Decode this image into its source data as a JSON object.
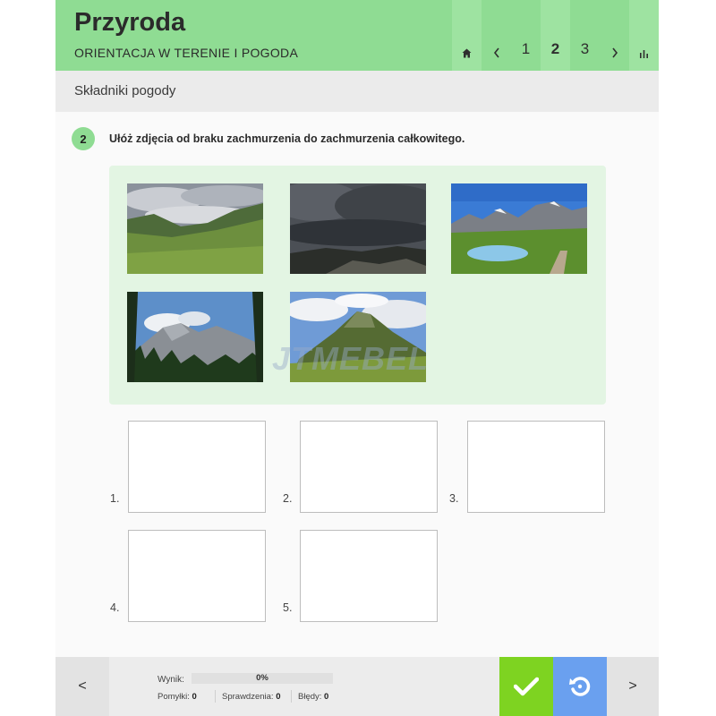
{
  "header": {
    "title": "Przyroda",
    "subtitle": "ORIENTACJA W TERENIE I POGODA",
    "nav": {
      "home_icon": "home-icon",
      "prev_icon": "chevron-left-icon",
      "pages": [
        "1",
        "2",
        "3"
      ],
      "active_page": "2",
      "next_icon": "chevron-right-icon",
      "stats_icon": "bar-chart-icon"
    }
  },
  "section": {
    "title": "Składniki pogody"
  },
  "question": {
    "number": "2",
    "text": "Ułóż zdjęcia od braku zachmurzenia do zachmurzenia całkowitego."
  },
  "pool": {
    "photos": [
      "valley-partly-cloudy-photo",
      "overcast-storm-clouds-photo",
      "clear-sky-alpine-lake-photo",
      "cloudy-mountain-forest-photo",
      "mountain-scattered-clouds-photo"
    ]
  },
  "watermark": "JTMEBEL",
  "slots": [
    "1.",
    "2.",
    "3.",
    "4.",
    "5."
  ],
  "footer": {
    "prev_label": "<",
    "next_label": ">",
    "score_label": "Wynik:",
    "score_value": "0%",
    "score_fraction": 0,
    "mistakes_label": "Pomyłki:",
    "mistakes_value": "0",
    "checks_label": "Sprawdzenia:",
    "checks_value": "0",
    "errors_label": "Błędy:",
    "errors_value": "0",
    "check_icon": "checkmark-icon",
    "reset_icon": "reset-icon"
  },
  "colors": {
    "accent": "#8fdc93",
    "pool_bg": "#e3f5e3",
    "check": "#7ed321",
    "reset": "#6aa0ef"
  }
}
